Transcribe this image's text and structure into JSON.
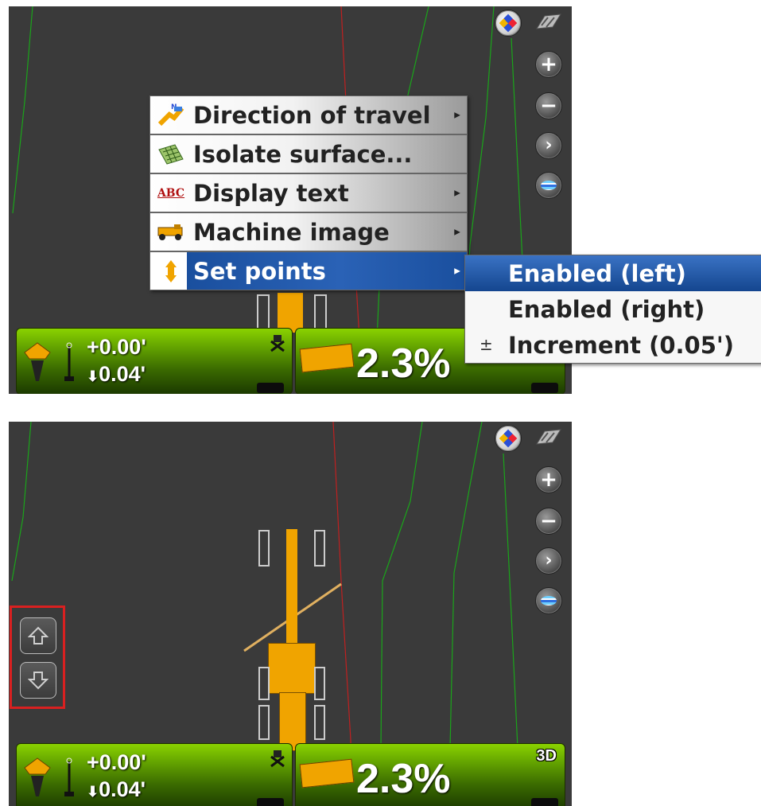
{
  "top_view": {
    "context_menu": {
      "items": [
        {
          "label": "Direction of travel",
          "icon": "direction-of-travel-icon",
          "has_submenu": true
        },
        {
          "label": "Isolate surface...",
          "icon": "isolate-surface-icon",
          "has_submenu": false
        },
        {
          "label": "Display text",
          "icon": "display-text-icon",
          "icon_text": "ABC",
          "has_submenu": true
        },
        {
          "label": "Machine image",
          "icon": "machine-image-icon",
          "has_submenu": true
        },
        {
          "label": "Set points",
          "icon": "set-points-icon",
          "has_submenu": true,
          "highlighted": true
        }
      ]
    },
    "submenu": {
      "items": [
        {
          "label": "Enabled (left)",
          "selected": true
        },
        {
          "label": "Enabled (right)",
          "selected": false
        },
        {
          "label": "Increment (0.05')",
          "icon": "increment-icon",
          "selected": false
        }
      ]
    },
    "left_panel": {
      "elevation_offset": "+0.00'",
      "cut_value": "0.04'"
    },
    "right_panel": {
      "slope": "2.3%"
    }
  },
  "bottom_view": {
    "left_panel": {
      "elevation_offset": "+0.00'",
      "cut_value": "0.04'"
    },
    "right_panel": {
      "slope": "2.3%",
      "mode_badge": "3D"
    },
    "setpoint_buttons": [
      "setpoint-up-button",
      "setpoint-down-button"
    ]
  },
  "map_tools": [
    "orientation-icon",
    "zoom-in-icon",
    "zoom-out-icon",
    "next-icon",
    "layers-icon"
  ],
  "colors": {
    "map_background": "#3a3a3a",
    "panel_green": "#64a400",
    "machine_orange": "#f0a400",
    "menu_highlight": "#1a4f9e",
    "callout_red": "#d92020"
  }
}
